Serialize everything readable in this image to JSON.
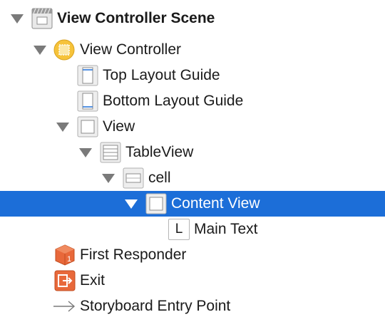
{
  "outline": {
    "scene": "View Controller Scene",
    "view_controller": "View Controller",
    "top_layout_guide": "Top Layout Guide",
    "bottom_layout_guide": "Bottom Layout Guide",
    "view": "View",
    "table_view": "TableView",
    "cell": "cell",
    "content_view": "Content View",
    "main_text": "Main Text",
    "main_text_icon_glyph": "L",
    "first_responder": "First Responder",
    "exit": "Exit",
    "storyboard_entry_point": "Storyboard Entry Point"
  },
  "colors": {
    "selection": "#1c6ed8",
    "disclosure": "#7a7a7a",
    "view_controller_icon": "#f6c33a",
    "first_responder_icon": "#e8683a",
    "exit_icon": "#e8683a"
  },
  "selected_item": "Content View"
}
